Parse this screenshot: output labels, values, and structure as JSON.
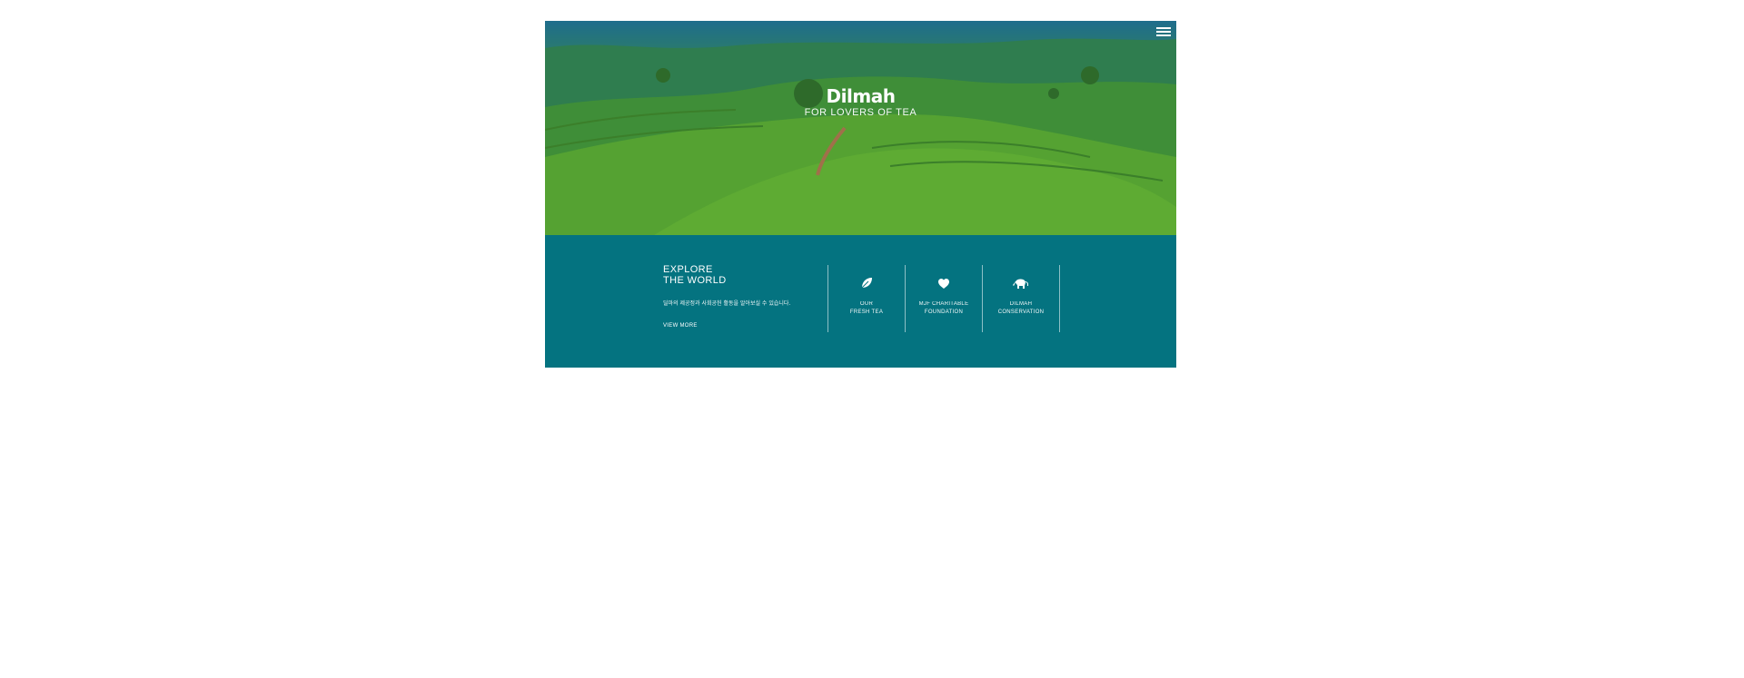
{
  "header": {
    "brand": "Dilmah",
    "tagline": "FOR LOVERS OF TEA",
    "menu_icon": "hamburger-menu-icon"
  },
  "explore": {
    "title_line1": "EXPLORE",
    "title_line2": "THE WORLD",
    "description": "딜마의 제공정과 사회공헌 활동을 알아보실 수 있습니다.",
    "view_more": "VIEW MORE"
  },
  "features": [
    {
      "icon": "leaf-icon",
      "line1": "OUR",
      "line2": "FRESH TEA"
    },
    {
      "icon": "heart-icon",
      "line1": "MJF CHARITABLE",
      "line2": "FOUNDATION"
    },
    {
      "icon": "elephant-icon",
      "line1": "DILMAH",
      "line2": "CONSERVATION"
    }
  ],
  "colors": {
    "teal_panel": "#047380",
    "hero_green": "#4f9a2f",
    "sky_blue": "#1f6d8c",
    "text": "#ffffff"
  }
}
